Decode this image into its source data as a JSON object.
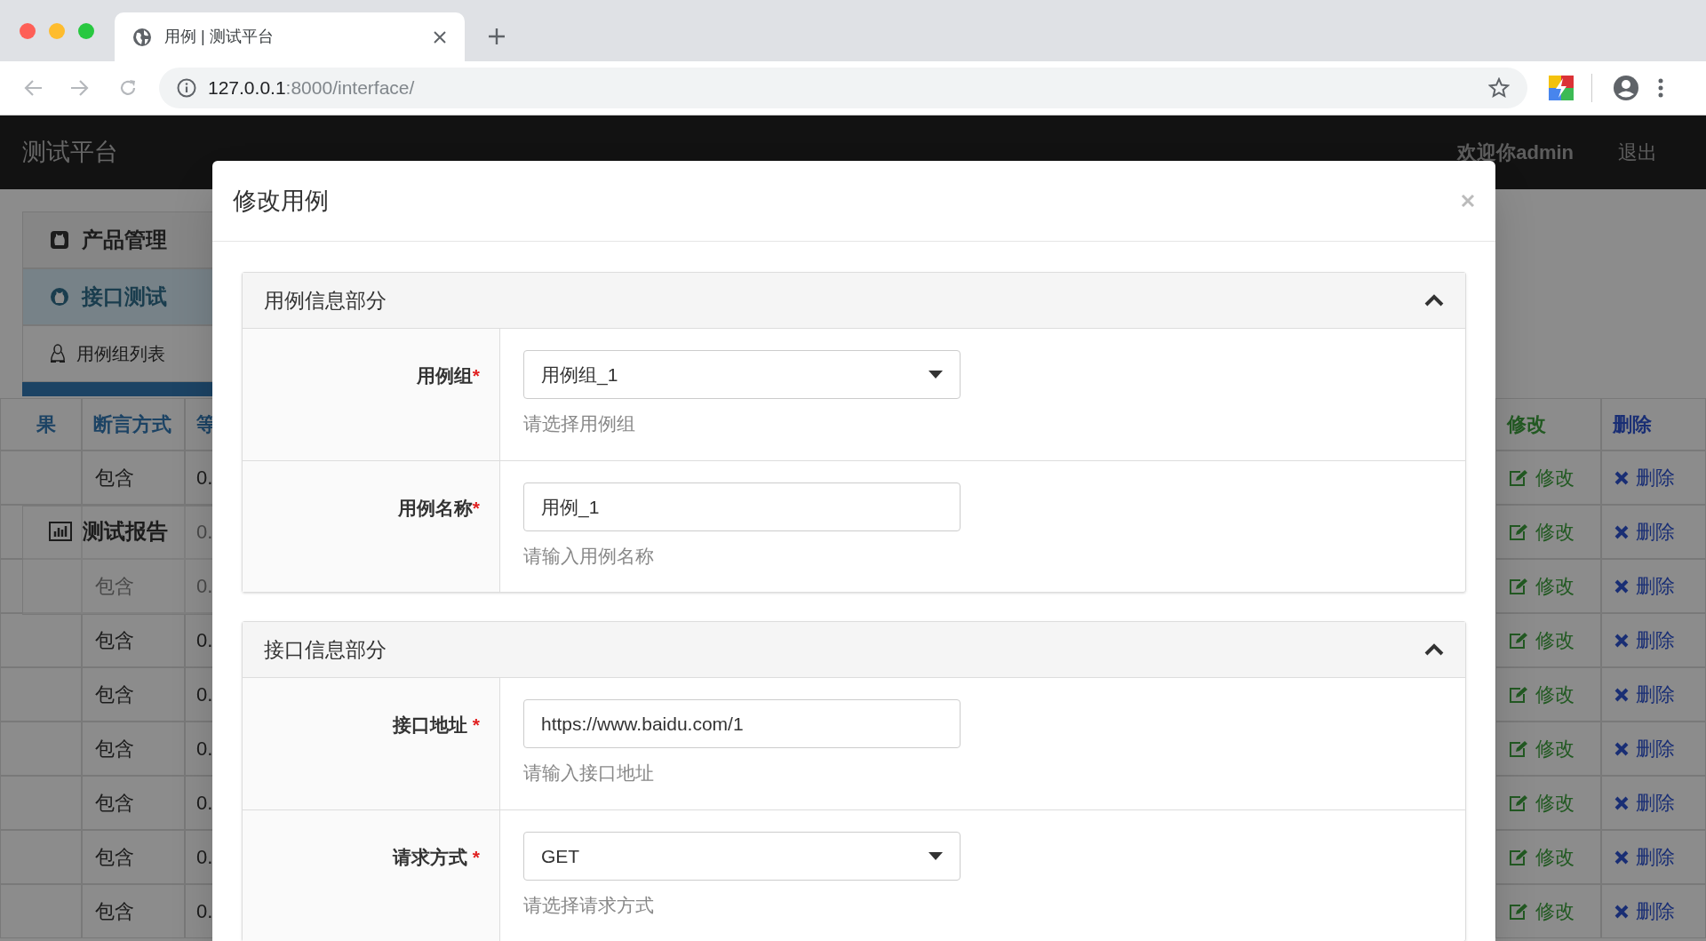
{
  "browser": {
    "tab_title": "用例 | 测试平台",
    "url_host": "127.0.0.1",
    "url_path": ":8000/interface/"
  },
  "navbar": {
    "brand": "测试平台",
    "user": "欢迎你admin",
    "logout": "退出"
  },
  "sidebar": {
    "items": [
      {
        "label": "产品管理",
        "kind": "section",
        "selected": false
      },
      {
        "label": "接口测试",
        "kind": "section",
        "selected": true
      },
      {
        "label": "用例组列表",
        "kind": "subitem",
        "selected": false
      }
    ],
    "report": "测试报告"
  },
  "table": {
    "columns": [
      "果",
      "断言方式",
      "等",
      "修改",
      "删除"
    ],
    "rows": [
      {
        "assertion": "包含",
        "column_3": "0.",
        "edit": "修改",
        "delete": "删除"
      },
      {
        "column_3": "0.",
        "edit": "修改",
        "delete": "删除"
      },
      {
        "assertion": "包含",
        "column_3": "0.",
        "edit": "修改",
        "delete": "删除"
      },
      {
        "assertion": "包含",
        "column_3": "0.",
        "edit": "修改",
        "delete": "删除"
      },
      {
        "assertion": "包含",
        "column_3": "0.",
        "edit": "修改",
        "delete": "删除"
      },
      {
        "assertion": "包含",
        "column_3": "0.",
        "edit": "修改",
        "delete": "删除"
      },
      {
        "assertion": "包含",
        "column_3": "0.",
        "edit": "修改",
        "delete": "删除"
      },
      {
        "assertion": "包含",
        "column_3": "0.",
        "edit": "修改",
        "delete": "删除"
      },
      {
        "assertion": "包含",
        "column_3": "0.",
        "edit": "修改",
        "delete": "删除"
      }
    ]
  },
  "modal": {
    "title": "修改用例",
    "sections": [
      {
        "heading": "用例信息部分",
        "expanded": true,
        "fields": [
          {
            "kind": "select",
            "label": "用例组",
            "required_mark": "*",
            "value": "用例组_1",
            "help": "请选择用例组"
          },
          {
            "kind": "text",
            "label": "用例名称",
            "required_mark": "*",
            "value": "用例_1",
            "help": "请输入用例名称"
          }
        ]
      },
      {
        "heading": "接口信息部分",
        "expanded": true,
        "fields": [
          {
            "kind": "text",
            "label": "接口地址 ",
            "required_mark": "*",
            "value": "https://www.baidu.com/1",
            "help": "请输入接口地址"
          },
          {
            "kind": "select",
            "label": "请求方式 ",
            "required_mark": "*",
            "value": "GET",
            "help": "请选择请求方式"
          }
        ]
      }
    ]
  }
}
